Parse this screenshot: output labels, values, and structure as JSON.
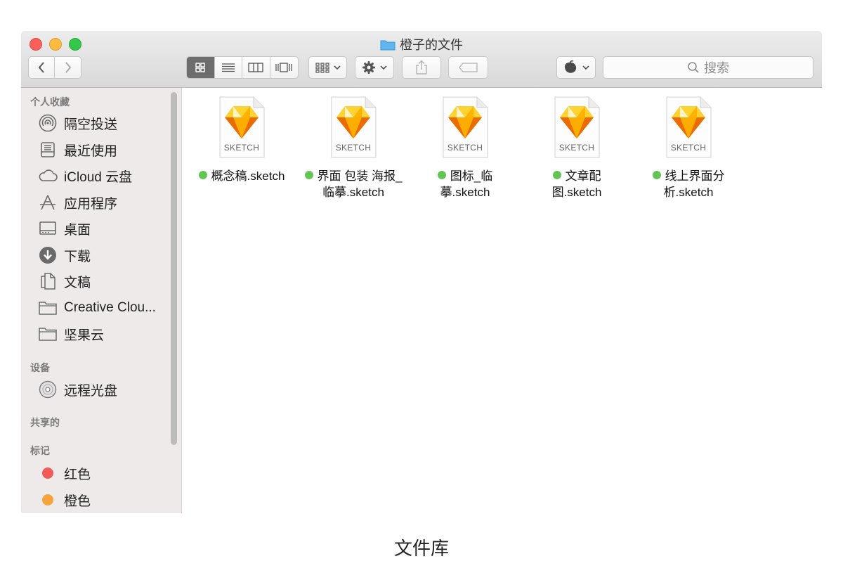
{
  "window": {
    "title": "橙子的文件"
  },
  "toolbar": {
    "search_placeholder": "搜索"
  },
  "sidebar": {
    "sections": [
      {
        "heading": "个人收藏",
        "items": [
          "隔空投送",
          "最近使用",
          "iCloud 云盘",
          "应用程序",
          "桌面",
          "下载",
          "文稿",
          "Creative Clou...",
          "坚果云"
        ]
      },
      {
        "heading": "设备",
        "items": [
          "远程光盘"
        ]
      },
      {
        "heading": "共享的",
        "items": []
      },
      {
        "heading": "标记",
        "items": [
          "红色",
          "橙色"
        ]
      }
    ],
    "tag_colors": {
      "red": "#f05a57",
      "orange": "#f7a33b"
    }
  },
  "files": [
    {
      "line1": "概念稿.sketch",
      "line2": "",
      "badge": "SKETCH"
    },
    {
      "line1": "界面 包装 海报_",
      "line2": "临摹.sketch",
      "badge": "SKETCH"
    },
    {
      "line1": "图标_临",
      "line2": "摹.sketch",
      "badge": "SKETCH"
    },
    {
      "line1": "文章配",
      "line2": "图.sketch",
      "badge": "SKETCH"
    },
    {
      "line1": "线上界面分",
      "line2": "析.sketch",
      "badge": "SKETCH"
    }
  ],
  "tag_dot_color": "#62c554",
  "caption": "文件库"
}
